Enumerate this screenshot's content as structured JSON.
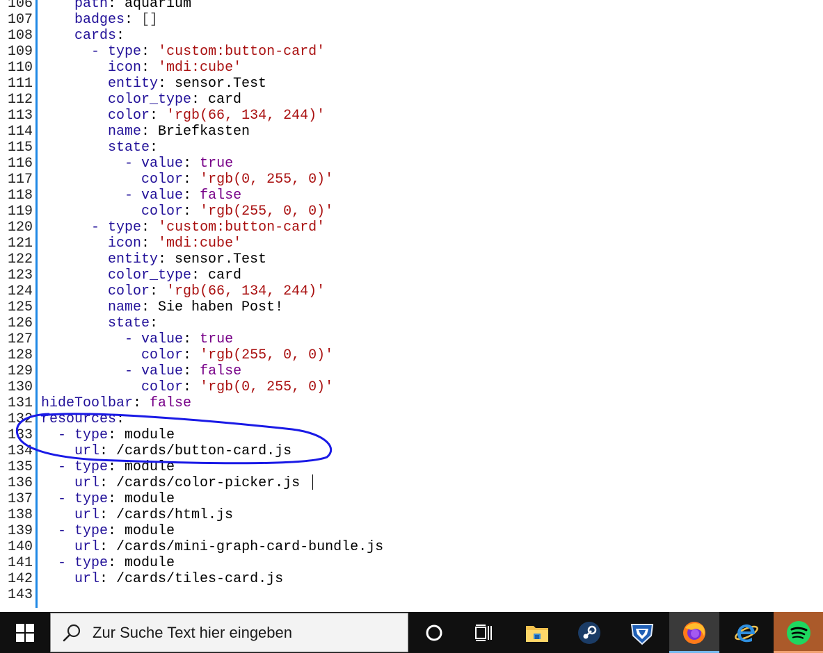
{
  "editor": {
    "lines": [
      {
        "n": "106",
        "tokens": [
          {
            "t": "    "
          },
          {
            "t": "path",
            "c": "key"
          },
          {
            "t": ": aquarium",
            "c": "pl"
          }
        ]
      },
      {
        "n": "107",
        "tokens": [
          {
            "t": "    "
          },
          {
            "t": "badges",
            "c": "key"
          },
          {
            "t": ": ",
            "c": "pl"
          },
          {
            "t": "[]",
            "c": "br"
          }
        ]
      },
      {
        "n": "108",
        "tokens": [
          {
            "t": "    "
          },
          {
            "t": "cards",
            "c": "key"
          },
          {
            "t": ":",
            "c": "pl"
          }
        ]
      },
      {
        "n": "109",
        "tokens": [
          {
            "t": "      "
          },
          {
            "t": "- ",
            "c": "dash"
          },
          {
            "t": "type",
            "c": "key"
          },
          {
            "t": ": ",
            "c": "pl"
          },
          {
            "t": "'custom:button-card'",
            "c": "str"
          }
        ]
      },
      {
        "n": "110",
        "tokens": [
          {
            "t": "        "
          },
          {
            "t": "icon",
            "c": "key"
          },
          {
            "t": ": ",
            "c": "pl"
          },
          {
            "t": "'mdi:cube'",
            "c": "str"
          }
        ]
      },
      {
        "n": "111",
        "tokens": [
          {
            "t": "        "
          },
          {
            "t": "entity",
            "c": "key"
          },
          {
            "t": ": sensor.Test",
            "c": "pl"
          }
        ]
      },
      {
        "n": "112",
        "tokens": [
          {
            "t": "        "
          },
          {
            "t": "color_type",
            "c": "key"
          },
          {
            "t": ": card",
            "c": "pl"
          }
        ]
      },
      {
        "n": "113",
        "tokens": [
          {
            "t": "        "
          },
          {
            "t": "color",
            "c": "key"
          },
          {
            "t": ": ",
            "c": "pl"
          },
          {
            "t": "'rgb(66, 134, 244)'",
            "c": "str"
          }
        ]
      },
      {
        "n": "114",
        "tokens": [
          {
            "t": "        "
          },
          {
            "t": "name",
            "c": "key"
          },
          {
            "t": ": Briefkasten",
            "c": "pl"
          }
        ]
      },
      {
        "n": "115",
        "tokens": [
          {
            "t": "        "
          },
          {
            "t": "state",
            "c": "key"
          },
          {
            "t": ":",
            "c": "pl"
          }
        ]
      },
      {
        "n": "116",
        "tokens": [
          {
            "t": "          "
          },
          {
            "t": "- ",
            "c": "dash"
          },
          {
            "t": "value",
            "c": "key"
          },
          {
            "t": ": ",
            "c": "pl"
          },
          {
            "t": "true",
            "c": "kw"
          }
        ]
      },
      {
        "n": "117",
        "tokens": [
          {
            "t": "            "
          },
          {
            "t": "color",
            "c": "key"
          },
          {
            "t": ": ",
            "c": "pl"
          },
          {
            "t": "'rgb(0, 255, 0)'",
            "c": "str"
          }
        ]
      },
      {
        "n": "118",
        "tokens": [
          {
            "t": "          "
          },
          {
            "t": "- ",
            "c": "dash"
          },
          {
            "t": "value",
            "c": "key"
          },
          {
            "t": ": ",
            "c": "pl"
          },
          {
            "t": "false",
            "c": "kw"
          }
        ]
      },
      {
        "n": "119",
        "tokens": [
          {
            "t": "            "
          },
          {
            "t": "color",
            "c": "key"
          },
          {
            "t": ": ",
            "c": "pl"
          },
          {
            "t": "'rgb(255, 0, 0)'",
            "c": "str"
          }
        ]
      },
      {
        "n": "120",
        "tokens": [
          {
            "t": "      "
          },
          {
            "t": "- ",
            "c": "dash"
          },
          {
            "t": "type",
            "c": "key"
          },
          {
            "t": ": ",
            "c": "pl"
          },
          {
            "t": "'custom:button-card'",
            "c": "str"
          }
        ]
      },
      {
        "n": "121",
        "tokens": [
          {
            "t": "        "
          },
          {
            "t": "icon",
            "c": "key"
          },
          {
            "t": ": ",
            "c": "pl"
          },
          {
            "t": "'mdi:cube'",
            "c": "str"
          }
        ]
      },
      {
        "n": "122",
        "tokens": [
          {
            "t": "        "
          },
          {
            "t": "entity",
            "c": "key"
          },
          {
            "t": ": sensor.Test",
            "c": "pl"
          }
        ]
      },
      {
        "n": "123",
        "tokens": [
          {
            "t": "        "
          },
          {
            "t": "color_type",
            "c": "key"
          },
          {
            "t": ": card",
            "c": "pl"
          }
        ]
      },
      {
        "n": "124",
        "tokens": [
          {
            "t": "        "
          },
          {
            "t": "color",
            "c": "key"
          },
          {
            "t": ": ",
            "c": "pl"
          },
          {
            "t": "'rgb(66, 134, 244)'",
            "c": "str"
          }
        ]
      },
      {
        "n": "125",
        "tokens": [
          {
            "t": "        "
          },
          {
            "t": "name",
            "c": "key"
          },
          {
            "t": ": Sie haben Post!",
            "c": "pl"
          }
        ]
      },
      {
        "n": "126",
        "tokens": [
          {
            "t": "        "
          },
          {
            "t": "state",
            "c": "key"
          },
          {
            "t": ":",
            "c": "pl"
          }
        ]
      },
      {
        "n": "127",
        "tokens": [
          {
            "t": "          "
          },
          {
            "t": "- ",
            "c": "dash"
          },
          {
            "t": "value",
            "c": "key"
          },
          {
            "t": ": ",
            "c": "pl"
          },
          {
            "t": "true",
            "c": "kw"
          }
        ]
      },
      {
        "n": "128",
        "tokens": [
          {
            "t": "            "
          },
          {
            "t": "color",
            "c": "key"
          },
          {
            "t": ": ",
            "c": "pl"
          },
          {
            "t": "'rgb(255, 0, 0)'",
            "c": "str"
          }
        ]
      },
      {
        "n": "129",
        "tokens": [
          {
            "t": "          "
          },
          {
            "t": "- ",
            "c": "dash"
          },
          {
            "t": "value",
            "c": "key"
          },
          {
            "t": ": ",
            "c": "pl"
          },
          {
            "t": "false",
            "c": "kw"
          }
        ]
      },
      {
        "n": "130",
        "tokens": [
          {
            "t": "            "
          },
          {
            "t": "color",
            "c": "key"
          },
          {
            "t": ": ",
            "c": "pl"
          },
          {
            "t": "'rgb(0, 255, 0)'",
            "c": "str"
          }
        ]
      },
      {
        "n": "131",
        "tokens": [
          {
            "t": "hideToolbar",
            "c": "key"
          },
          {
            "t": ": ",
            "c": "pl"
          },
          {
            "t": "false",
            "c": "kw"
          }
        ]
      },
      {
        "n": "132",
        "tokens": [
          {
            "t": "resources",
            "c": "key"
          },
          {
            "t": ":",
            "c": "pl"
          }
        ]
      },
      {
        "n": "133",
        "tokens": [
          {
            "t": "  "
          },
          {
            "t": "- ",
            "c": "dash"
          },
          {
            "t": "type",
            "c": "key"
          },
          {
            "t": ": module",
            "c": "pl"
          }
        ]
      },
      {
        "n": "134",
        "tokens": [
          {
            "t": "    "
          },
          {
            "t": "url",
            "c": "key"
          },
          {
            "t": ": /cards/button-card.js",
            "c": "pl"
          }
        ]
      },
      {
        "n": "135",
        "tokens": [
          {
            "t": "  "
          },
          {
            "t": "- ",
            "c": "dash"
          },
          {
            "t": "type",
            "c": "key"
          },
          {
            "t": ": module",
            "c": "pl"
          }
        ]
      },
      {
        "n": "136",
        "tokens": [
          {
            "t": "    "
          },
          {
            "t": "url",
            "c": "key"
          },
          {
            "t": ": /cards/color-picker.js",
            "c": "pl"
          }
        ]
      },
      {
        "n": "137",
        "tokens": [
          {
            "t": "  "
          },
          {
            "t": "- ",
            "c": "dash"
          },
          {
            "t": "type",
            "c": "key"
          },
          {
            "t": ": module",
            "c": "pl"
          }
        ]
      },
      {
        "n": "138",
        "tokens": [
          {
            "t": "    "
          },
          {
            "t": "url",
            "c": "key"
          },
          {
            "t": ": /cards/html.js",
            "c": "pl"
          }
        ]
      },
      {
        "n": "139",
        "tokens": [
          {
            "t": "  "
          },
          {
            "t": "- ",
            "c": "dash"
          },
          {
            "t": "type",
            "c": "key"
          },
          {
            "t": ": module",
            "c": "pl"
          }
        ]
      },
      {
        "n": "140",
        "tokens": [
          {
            "t": "    "
          },
          {
            "t": "url",
            "c": "key"
          },
          {
            "t": ": /cards/mini-graph-card-bundle.js",
            "c": "pl"
          }
        ]
      },
      {
        "n": "141",
        "tokens": [
          {
            "t": "  "
          },
          {
            "t": "- ",
            "c": "dash"
          },
          {
            "t": "type",
            "c": "key"
          },
          {
            "t": ": module",
            "c": "pl"
          }
        ]
      },
      {
        "n": "142",
        "tokens": [
          {
            "t": "    "
          },
          {
            "t": "url",
            "c": "key"
          },
          {
            "t": ": /cards/tiles-card.js",
            "c": "pl"
          }
        ]
      },
      {
        "n": "143",
        "tokens": []
      }
    ],
    "colors": {
      "key": "#221199",
      "string": "#aa1111",
      "keyword": "#770088",
      "gutter_accent": "#1e88e5",
      "annotation": "#1a1ae6"
    }
  },
  "taskbar": {
    "search_placeholder": "Zur Suche Text hier eingeben",
    "icons": [
      "windows-start-icon",
      "search-icon",
      "cortana-icon",
      "task-view-icon",
      "file-explorer-icon",
      "steam-icon",
      "rocket-league-icon",
      "firefox-icon",
      "internet-explorer-icon",
      "spotify-icon"
    ],
    "active_app": "firefox",
    "colors": {
      "background": "#101010",
      "active": "#3a3a3a",
      "spotify_highlight": "#ab5a2a"
    }
  }
}
